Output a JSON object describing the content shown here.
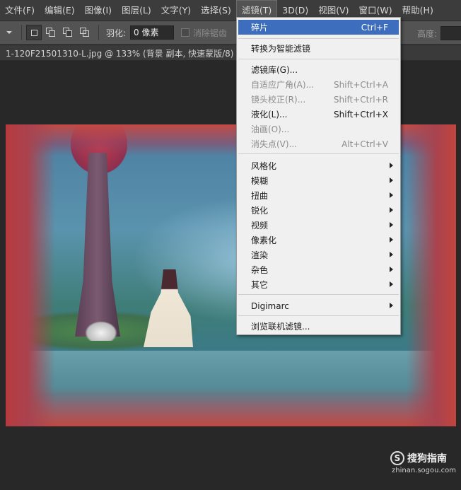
{
  "menubar": {
    "items": [
      "文件(F)",
      "编辑(E)",
      "图像(I)",
      "图层(L)",
      "文字(Y)",
      "选择(S)",
      "滤镜(T)",
      "3D(D)",
      "视图(V)",
      "窗口(W)",
      "帮助(H)"
    ],
    "active_index": 6
  },
  "options_bar": {
    "feather_label": "羽化:",
    "feather_value": "0 像素",
    "antialias_label": "消除锯齿",
    "height_label": "高度:"
  },
  "document_tab": {
    "title": "1-120F21501310-L.jpg @ 133% (背景 副本, 快速蒙版/8) *"
  },
  "filter_menu": {
    "items": [
      {
        "label": "碎片",
        "shortcut": "Ctrl+F",
        "state": "highlight"
      },
      {
        "label": "转换为智能滤镜",
        "shortcut": "",
        "state": "normal"
      },
      {
        "label": "滤镜库(G)...",
        "shortcut": "",
        "state": "normal"
      },
      {
        "label": "自适应广角(A)...",
        "shortcut": "Shift+Ctrl+A",
        "state": "disabled"
      },
      {
        "label": "镜头校正(R)...",
        "shortcut": "Shift+Ctrl+R",
        "state": "disabled"
      },
      {
        "label": "液化(L)...",
        "shortcut": "Shift+Ctrl+X",
        "state": "normal"
      },
      {
        "label": "油画(O)...",
        "shortcut": "",
        "state": "disabled"
      },
      {
        "label": "消失点(V)...",
        "shortcut": "Alt+Ctrl+V",
        "state": "disabled"
      },
      {
        "label": "风格化",
        "shortcut": "",
        "state": "submenu"
      },
      {
        "label": "模糊",
        "shortcut": "",
        "state": "submenu"
      },
      {
        "label": "扭曲",
        "shortcut": "",
        "state": "submenu"
      },
      {
        "label": "锐化",
        "shortcut": "",
        "state": "submenu"
      },
      {
        "label": "视频",
        "shortcut": "",
        "state": "submenu"
      },
      {
        "label": "像素化",
        "shortcut": "",
        "state": "submenu"
      },
      {
        "label": "渲染",
        "shortcut": "",
        "state": "submenu"
      },
      {
        "label": "杂色",
        "shortcut": "",
        "state": "submenu"
      },
      {
        "label": "其它",
        "shortcut": "",
        "state": "submenu"
      },
      {
        "label": "Digimarc",
        "shortcut": "",
        "state": "submenu"
      },
      {
        "label": "浏览联机滤镜...",
        "shortcut": "",
        "state": "normal"
      }
    ]
  },
  "watermark": {
    "logo": "S",
    "brand": "搜狗指南",
    "url": "zhinan.sogou.com"
  },
  "colors": {
    "menu_highlight": "#3d6ebe",
    "menubar_bg": "#3c3c3c",
    "optbar_bg": "#535353",
    "workspace_bg": "#282828"
  }
}
